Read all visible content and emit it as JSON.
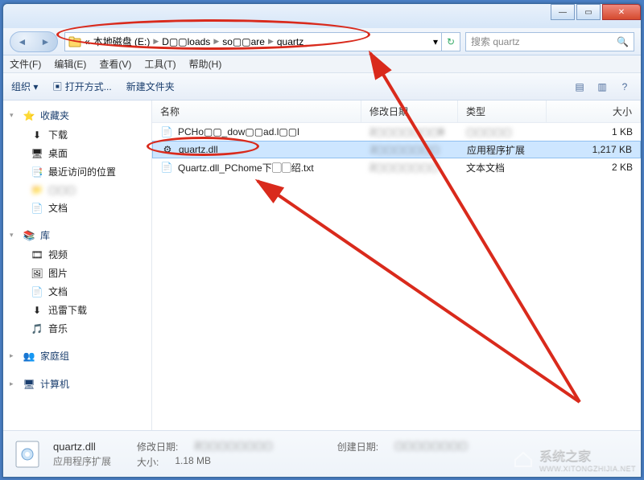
{
  "window": {
    "minimize": "—",
    "maximize": "▭",
    "close": "✕"
  },
  "nav": {
    "back": "◄",
    "forward": "►",
    "dropdown": "▾",
    "refresh": "↻"
  },
  "address": {
    "prefix": "«",
    "segments": [
      "本地磁盘 (E:)",
      "D▢▢loads",
      "so▢▢are",
      "quartz"
    ]
  },
  "search": {
    "placeholder": "搜索 quartz",
    "icon": "🔍"
  },
  "menubar": [
    "文件(F)",
    "编辑(E)",
    "查看(V)",
    "工具(T)",
    "帮助(H)"
  ],
  "toolbar": {
    "organize": "组织 ▾",
    "openwith": "打开方式...",
    "newfolder": "新建文件夹",
    "viewicon": "▤",
    "helpicon": "?"
  },
  "sidebar": {
    "favorites": {
      "label": "收藏夹",
      "items": [
        "下载",
        "桌面",
        "最近访问的位置",
        "▢▢▢",
        "文档"
      ]
    },
    "libraries": {
      "label": "库",
      "items": [
        "视频",
        "图片",
        "文档",
        "迅雷下载",
        "音乐"
      ]
    },
    "homegroup": {
      "label": "家庭组"
    },
    "computer": {
      "label": "计算机"
    }
  },
  "columns": {
    "name": "名称",
    "date": "修改日期",
    "type": "类型",
    "size": "大小"
  },
  "files": [
    {
      "name": "PCHo▢▢_dow▢▢ad.l▢▢l",
      "date": "2▢▢▢▢▢▢▢8",
      "type": "▢▢▢▢▢",
      "size": "1 KB",
      "selected": false
    },
    {
      "name": "quartz.dll",
      "date": "2▢▢▢▢▢▢▢",
      "type": "应用程序扩展",
      "size": "1,217 KB",
      "selected": true
    },
    {
      "name": "Quartz.dll_PChome下▢▢绍.txt",
      "date": "2▢▢▢▢▢▢▢",
      "type": "文本文档",
      "size": "2 KB",
      "selected": false
    }
  ],
  "details": {
    "filename": "quartz.dll",
    "typeline": "应用程序扩展",
    "modlabel": "修改日期:",
    "modval": "2▢▢▢▢▢▢▢▢",
    "createlabel": "创建日期:",
    "createval": "▢▢▢▢▢▢▢▢",
    "sizelabel": "大小:",
    "sizeval": "1.18 MB"
  },
  "watermark": {
    "text": "系统之家",
    "url": "WWW.XITONGZHIJIA.NET"
  }
}
